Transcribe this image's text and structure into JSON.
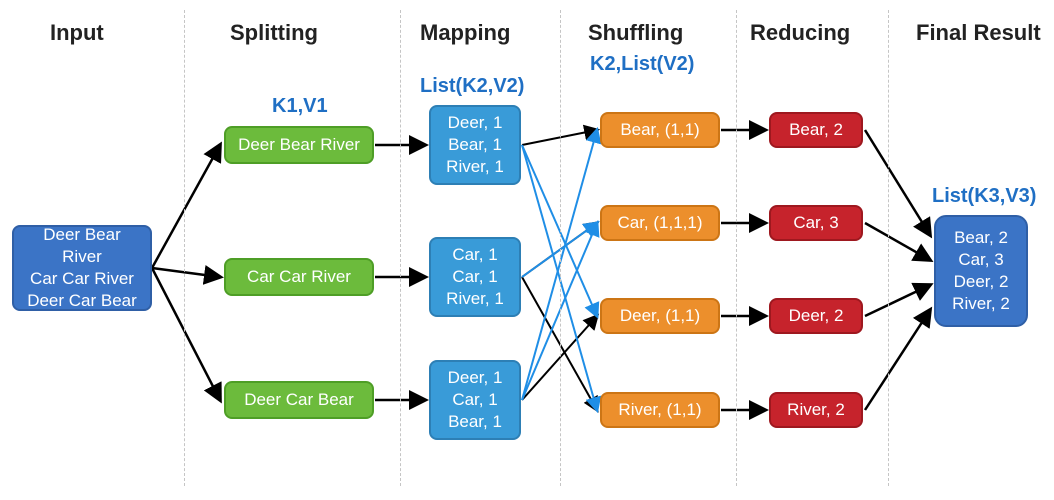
{
  "headers": {
    "input": "Input",
    "split": "Splitting",
    "map": "Mapping",
    "shuf": "Shuffling",
    "red": "Reducing",
    "final": "Final Result"
  },
  "labels": {
    "k1": "K1,V1",
    "k2": "List(K2,V2)",
    "k2l": "K2,List(V2)",
    "k3": "List(K3,V3)"
  },
  "input": [
    "Deer Bear River",
    "Car Car River",
    "Deer Car Bear"
  ],
  "splits": [
    "Deer Bear River",
    "Car Car River",
    "Deer Car Bear"
  ],
  "maps": [
    [
      "Deer, 1",
      "Bear, 1",
      "River, 1"
    ],
    [
      "Car, 1",
      "Car, 1",
      "River, 1"
    ],
    [
      "Deer, 1",
      "Car, 1",
      "Bear, 1"
    ]
  ],
  "shuffles": [
    "Bear, (1,1)",
    "Car, (1,1,1)",
    "Deer, (1,1)",
    "River, (1,1)"
  ],
  "reduces": [
    "Bear, 2",
    "Car, 3",
    "Deer, 2",
    "River, 2"
  ],
  "final": [
    "Bear, 2",
    "Car, 3",
    "Deer, 2",
    "River, 2"
  ]
}
